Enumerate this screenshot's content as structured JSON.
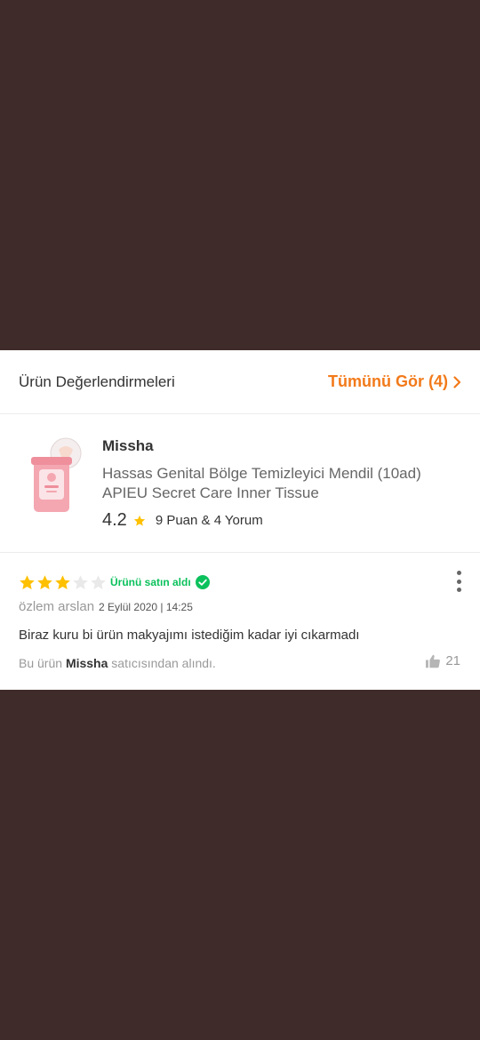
{
  "header": {
    "title": "Ürün Değerlendirmeleri",
    "see_all": "Tümünü Gör (4)"
  },
  "product": {
    "brand": "Missha",
    "name": "Hassas Genital Bölge Temizleyici Mendil (10ad) APIEU Secret Care Inner Tissue",
    "rating": "4.2",
    "rating_count": "9 Puan & 4 Yorum"
  },
  "review": {
    "stars": 3,
    "stars_max": 5,
    "verified_label": "Ürünü satın aldı",
    "author": "özlem arslan",
    "date": "2 Eylül 2020 | 14:25",
    "comment": "Biraz kuru bi ürün makyajımı istediğim kadar iyi cıkarmadı",
    "seller_prefix": "Bu ürün ",
    "seller_name": "Missha",
    "seller_suffix": " satıcısından alındı.",
    "likes": "21"
  },
  "colors": {
    "background": "#3f2b2a",
    "accent": "#f27a1a",
    "star": "#ffc000",
    "star_empty": "#e9e9e9",
    "verified": "#0bc15c"
  }
}
